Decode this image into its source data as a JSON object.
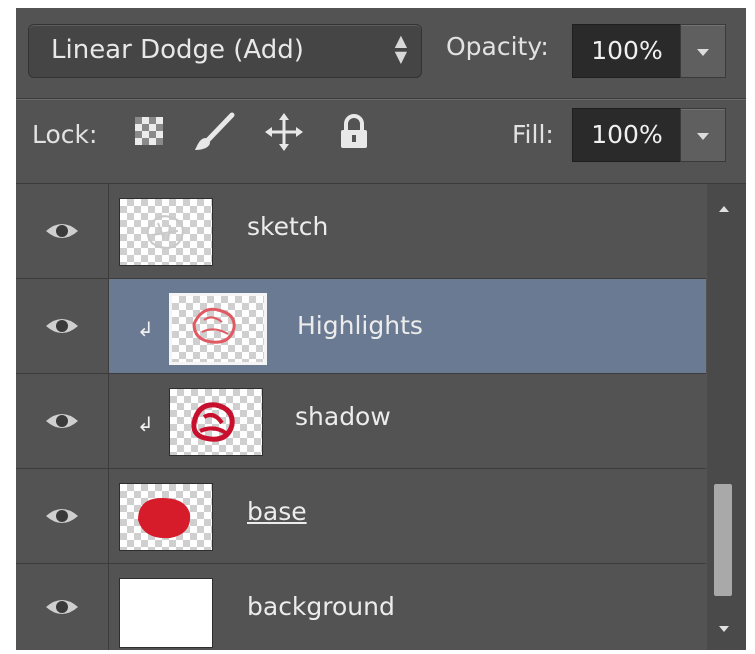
{
  "blend_mode": "Linear Dodge (Add)",
  "opacity": {
    "label": "Opacity:",
    "value": "100%"
  },
  "lock": {
    "label": "Lock:",
    "icons": [
      "transparent-pixels-lock-icon",
      "brush-lock-icon",
      "move-lock-icon",
      "lock-all-icon"
    ]
  },
  "fill": {
    "label": "Fill:",
    "value": "100%"
  },
  "layers": [
    {
      "name": "sketch",
      "selected": false,
      "clipped": false
    },
    {
      "name": "Highlights",
      "selected": true,
      "clipped": true
    },
    {
      "name": "shadow",
      "selected": false,
      "clipped": true
    },
    {
      "name": "base",
      "selected": false,
      "clipped": false,
      "underlined": true
    },
    {
      "name": "background",
      "selected": false,
      "clipped": false
    }
  ],
  "colors": {
    "panel": "#535353",
    "selected_row": "#6a7a92",
    "paint_red": "#d61c2b"
  }
}
